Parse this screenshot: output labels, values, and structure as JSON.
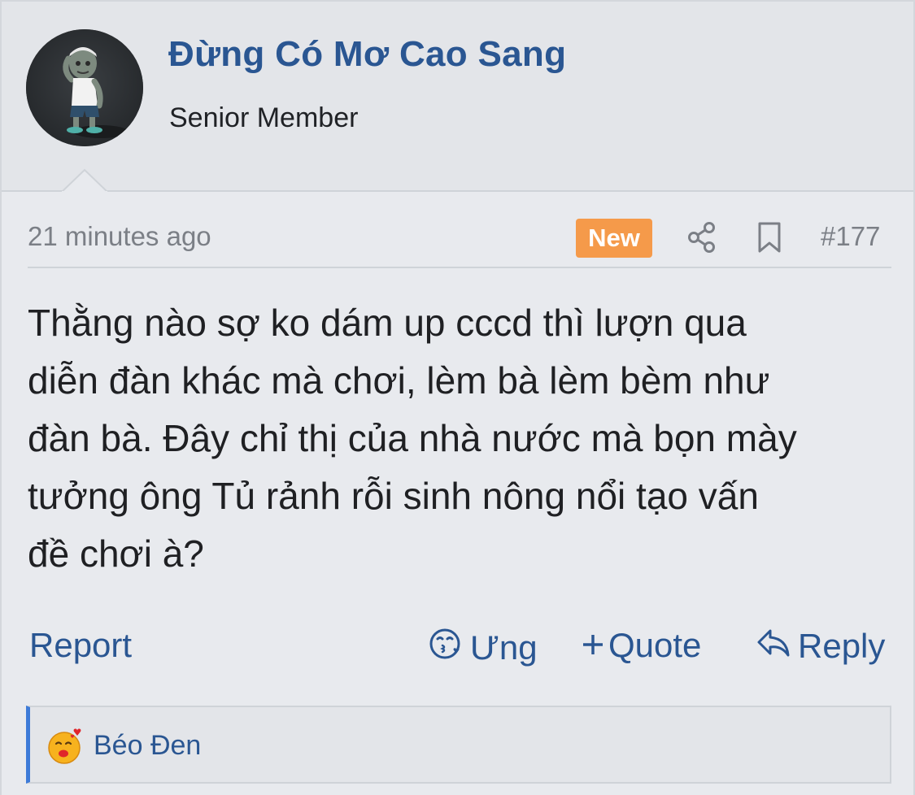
{
  "user": {
    "name": "Đừng Có Mơ Cao Sang",
    "title": "Senior Member"
  },
  "post": {
    "timestamp": "21 minutes ago",
    "badge": "New",
    "number": "#177",
    "lines": [
      "Thằng nào sợ ko dám up cccd thì lượn qua",
      "diễn đàn khác mà chơi, lèm bà lèm bèm như",
      "đàn bà. Đây chỉ thị của nhà nước mà bọn mày",
      "tưởng ông Tủ rảnh rỗi sinh nông nổi tạo vấn",
      "đề chơi à?"
    ]
  },
  "actions": {
    "report": "Report",
    "ung": "Ưng",
    "quote": "Quote",
    "reply": "Reply"
  },
  "reactions": {
    "users": "Béo Đen"
  },
  "colors": {
    "link": "#2a5692",
    "badge": "#f59a4a",
    "accent_bar": "#3d7bd8"
  },
  "icons": [
    "avatar",
    "share-icon",
    "bookmark-icon",
    "smile-kiss-icon",
    "plus-icon",
    "reply-arrow-icon",
    "kiss-emoji-icon"
  ]
}
